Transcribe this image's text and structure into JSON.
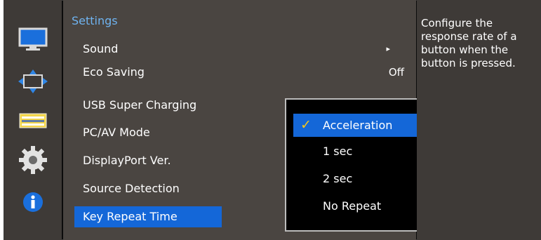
{
  "menu": {
    "title": "Settings",
    "items": [
      {
        "label": "Sound",
        "value": "▸"
      },
      {
        "label": "Eco Saving",
        "value": "Off"
      },
      {
        "label": "USB Super Charging",
        "value": ""
      },
      {
        "label": "PC/AV Mode",
        "value": ""
      },
      {
        "label": "DisplayPort Ver.",
        "value": ""
      },
      {
        "label": "Source Detection",
        "value": ""
      },
      {
        "label": "Key Repeat Time",
        "value": ""
      }
    ],
    "selected": "Key Repeat Time"
  },
  "dropdown": {
    "options": [
      "Acceleration",
      "1 sec",
      "2 sec",
      "No Repeat"
    ],
    "selected": "Acceleration"
  },
  "help": {
    "text": "Configure the response rate of a button when the button is pressed."
  },
  "sidebar_icons": [
    "monitor-icon",
    "resize-arrows-icon",
    "menu-list-icon",
    "gear-icon",
    "info-icon"
  ],
  "colors": {
    "accent": "#1467d8",
    "title": "#6fb3f0",
    "check": "#f2c51d"
  }
}
